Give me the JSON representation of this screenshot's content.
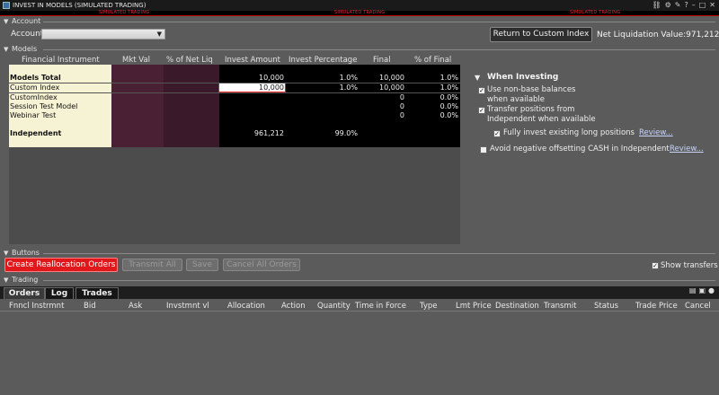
{
  "window": {
    "title": "INVEST IN MODELS (SIMULATED TRADING)",
    "sim_label": "SIMULATED TRADING"
  },
  "account_section": {
    "header": "Account",
    "account_label": "Account",
    "account_value": "",
    "return_button": "Return to Custom Index",
    "net_liq": "Net Liquidation Value:971,212"
  },
  "models_section": {
    "header": "Models",
    "columns": [
      "Financial Instrument",
      "Mkt Val",
      "% of Net Liq",
      "Invest Amount",
      "Invest Percentage",
      "Final",
      "% of Final"
    ],
    "rows": [
      {
        "name": "Models Total",
        "invest_amount": "10,000",
        "invest_pct": "1.0%",
        "final": "10,000",
        "pct_final": "1.0%"
      },
      {
        "name": "Custom Index",
        "invest_amount": "10,000",
        "invest_pct": "1.0%",
        "final": "10,000",
        "pct_final": "1.0%"
      },
      {
        "name": "CustomIndex",
        "invest_amount": "",
        "invest_pct": "",
        "final": "0",
        "pct_final": "0.0%"
      },
      {
        "name": "Session Test Model",
        "invest_amount": "",
        "invest_pct": "",
        "final": "0",
        "pct_final": "0.0%"
      },
      {
        "name": "Webinar Test",
        "invest_amount": "",
        "invest_pct": "",
        "final": "0",
        "pct_final": "0.0%"
      },
      {
        "name": "Independent",
        "invest_amount": "961,212",
        "invest_pct": "99.0%",
        "final": "",
        "pct_final": ""
      }
    ]
  },
  "when_investing": {
    "title": "When Investing",
    "options": [
      {
        "line1": "Use non-base balances",
        "line2": "when available",
        "checked": true
      },
      {
        "line1": "Transfer positions from",
        "line2": "Independent when available",
        "checked": true
      },
      {
        "line1": "Fully invest existing long positions",
        "link": "Review...",
        "checked": true
      },
      {
        "line1": "Avoid negative offsetting CASH in Independent",
        "link": "Review...",
        "checked": false
      }
    ]
  },
  "buttons_section": {
    "header": "Buttons",
    "create": "Create Reallocation Orders",
    "transmit_all": "Transmit All",
    "save": "Save",
    "cancel_all": "Cancel All Orders",
    "show_transfers": "Show transfers"
  },
  "trading_section": {
    "header": "Trading",
    "tabs": [
      "Orders",
      "Log",
      "Trades"
    ],
    "columns": [
      "Fnncl Instrmnt",
      "Bid",
      "Ask",
      "Invstmnt vl",
      "Allocation",
      "Action",
      "Quantity",
      "Time in Force",
      "Type",
      "Lmt Price",
      "Destination",
      "Transmit",
      "Status",
      "Trade Price",
      "Cancel"
    ]
  },
  "colors": {
    "create_button": "#e0181c",
    "edit_border": "#d22222",
    "sim_text": "#e22233"
  }
}
